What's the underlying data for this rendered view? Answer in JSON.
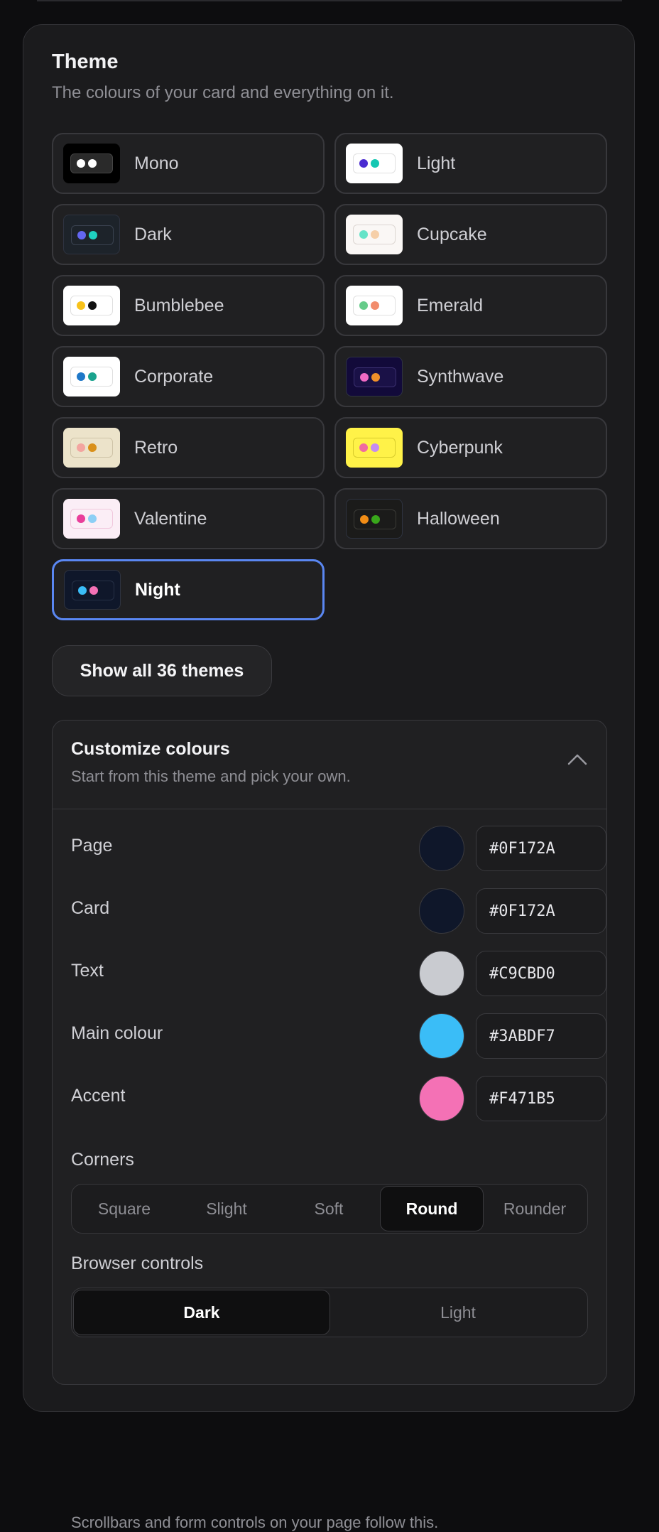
{
  "theme": {
    "title": "Theme",
    "subtitle": "The colours of your card and everything on it.",
    "show_all_label": "Show all 36 themes",
    "themes": [
      {
        "name": "Mono",
        "selected": false,
        "bg": "#000000",
        "frame": "#2a2a2a",
        "border": "#444444",
        "dots": [
          "#ffffff",
          "#ffffff"
        ]
      },
      {
        "name": "Light",
        "selected": false,
        "bg": "#ffffff",
        "frame": "#ffffff",
        "border": "#e0e0e0",
        "dots": [
          "#4a2bd1",
          "#14c7b2"
        ]
      },
      {
        "name": "Dark",
        "selected": false,
        "bg": "#1d232a",
        "frame": "#1d232a",
        "border": "#3a4250",
        "dots": [
          "#6366f1",
          "#1fd1c1"
        ]
      },
      {
        "name": "Cupcake",
        "selected": false,
        "bg": "#faf7f5",
        "frame": "#faf7f5",
        "border": "#dcd6d2",
        "dots": [
          "#65e3c8",
          "#f6cfa8"
        ]
      },
      {
        "name": "Bumblebee",
        "selected": false,
        "bg": "#ffffff",
        "frame": "#ffffff",
        "border": "#e0e0e0",
        "dots": [
          "#f8c21a",
          "#111111"
        ]
      },
      {
        "name": "Emerald",
        "selected": false,
        "bg": "#ffffff",
        "frame": "#ffffff",
        "border": "#e0e0e0",
        "dots": [
          "#66cc8a",
          "#f28c6c"
        ]
      },
      {
        "name": "Corporate",
        "selected": false,
        "bg": "#ffffff",
        "frame": "#ffffff",
        "border": "#e0e0e0",
        "dots": [
          "#1f78c8",
          "#1aa38e"
        ]
      },
      {
        "name": "Synthwave",
        "selected": false,
        "bg": "#120a3a",
        "frame": "#1a1147",
        "border": "#3a2f6e",
        "dots": [
          "#f06ac4",
          "#f0902a"
        ]
      },
      {
        "name": "Retro",
        "selected": false,
        "bg": "#ece3ca",
        "frame": "#ece3ca",
        "border": "#cfc4a8",
        "dots": [
          "#f3a5a0",
          "#d9901a"
        ]
      },
      {
        "name": "Cyberpunk",
        "selected": false,
        "bg": "#fff248",
        "frame": "#fff248",
        "border": "#d8cc2c",
        "dots": [
          "#f06ba0",
          "#c58cf0"
        ]
      },
      {
        "name": "Valentine",
        "selected": false,
        "bg": "#fbeef6",
        "frame": "#fbeef6",
        "border": "#f0c8dd",
        "dots": [
          "#e93e9a",
          "#8ccff5"
        ]
      },
      {
        "name": "Halloween",
        "selected": false,
        "bg": "#1b1b1a",
        "frame": "#1b1b1a",
        "border": "#3a3a36",
        "dots": [
          "#f28d16",
          "#39a71b"
        ]
      },
      {
        "name": "Night",
        "selected": true,
        "bg": "#0f172a",
        "frame": "#0f172a",
        "border": "#263046",
        "dots": [
          "#3abdf7",
          "#f471b5"
        ]
      }
    ]
  },
  "customize": {
    "title": "Customize colours",
    "subtitle": "Start from this theme and pick your own.",
    "colors": [
      {
        "label": "Page",
        "hex": "#0F172A",
        "swatch": "#0f172a"
      },
      {
        "label": "Card",
        "hex": "#0F172A",
        "swatch": "#0f172a"
      },
      {
        "label": "Text",
        "hex": "#C9CBD0",
        "swatch": "#c9cbd0"
      },
      {
        "label": "Main colour",
        "hex": "#3ABDF7",
        "swatch": "#3abdf7"
      },
      {
        "label": "Accent",
        "hex": "#F471B5",
        "swatch": "#f471b5"
      }
    ],
    "corners_label": "Corners",
    "corners_options": [
      "Square",
      "Slight",
      "Soft",
      "Round",
      "Rounder"
    ],
    "corners_selected": "Round",
    "browser_label": "Browser controls",
    "browser_options": [
      "Dark",
      "Light"
    ],
    "browser_selected": "Dark",
    "footnote": "Scrollbars and form controls on your page follow this."
  }
}
